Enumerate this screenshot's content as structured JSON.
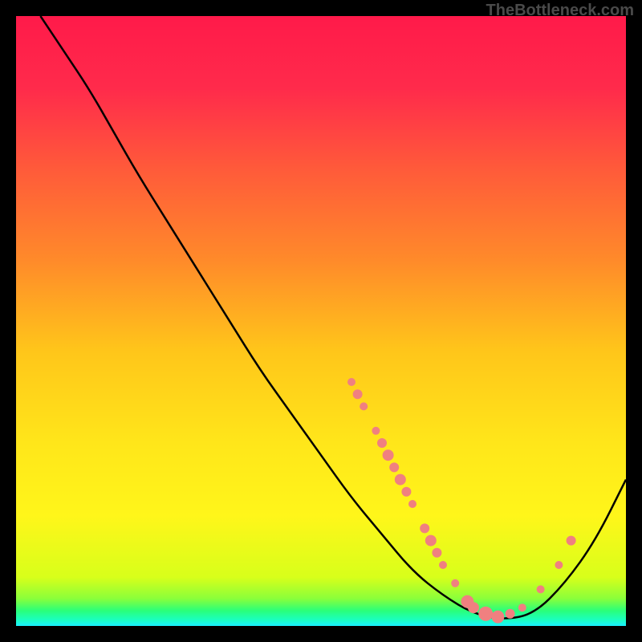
{
  "watermark": "TheBottleneck.com",
  "chart_data": {
    "type": "line",
    "title": "",
    "xlabel": "",
    "ylabel": "",
    "xlim": [
      0,
      100
    ],
    "ylim": [
      0,
      100
    ],
    "gradient_stops": [
      {
        "offset": 0,
        "color": "#ff1a4a"
      },
      {
        "offset": 0.12,
        "color": "#ff2b4b"
      },
      {
        "offset": 0.25,
        "color": "#ff5a3a"
      },
      {
        "offset": 0.4,
        "color": "#ff8a2a"
      },
      {
        "offset": 0.55,
        "color": "#ffc61a"
      },
      {
        "offset": 0.7,
        "color": "#ffe61a"
      },
      {
        "offset": 0.82,
        "color": "#fff61a"
      },
      {
        "offset": 0.92,
        "color": "#d8ff1a"
      },
      {
        "offset": 0.955,
        "color": "#8aff3a"
      },
      {
        "offset": 0.975,
        "color": "#2aff7a"
      },
      {
        "offset": 0.99,
        "color": "#1affc0"
      },
      {
        "offset": 1.0,
        "color": "#1af0ff"
      }
    ],
    "curve": [
      {
        "x": 4,
        "y": 100
      },
      {
        "x": 8,
        "y": 94
      },
      {
        "x": 12,
        "y": 88
      },
      {
        "x": 16,
        "y": 81
      },
      {
        "x": 20,
        "y": 74
      },
      {
        "x": 25,
        "y": 66
      },
      {
        "x": 30,
        "y": 58
      },
      {
        "x": 35,
        "y": 50
      },
      {
        "x": 40,
        "y": 42
      },
      {
        "x": 45,
        "y": 35
      },
      {
        "x": 50,
        "y": 28
      },
      {
        "x": 55,
        "y": 21
      },
      {
        "x": 60,
        "y": 15
      },
      {
        "x": 65,
        "y": 9
      },
      {
        "x": 70,
        "y": 5
      },
      {
        "x": 75,
        "y": 2
      },
      {
        "x": 80,
        "y": 1
      },
      {
        "x": 85,
        "y": 2
      },
      {
        "x": 90,
        "y": 7
      },
      {
        "x": 95,
        "y": 14
      },
      {
        "x": 100,
        "y": 24
      }
    ],
    "points": [
      {
        "x": 55,
        "y": 40,
        "r": 5
      },
      {
        "x": 56,
        "y": 38,
        "r": 6
      },
      {
        "x": 57,
        "y": 36,
        "r": 5
      },
      {
        "x": 59,
        "y": 32,
        "r": 5
      },
      {
        "x": 60,
        "y": 30,
        "r": 6
      },
      {
        "x": 61,
        "y": 28,
        "r": 7
      },
      {
        "x": 62,
        "y": 26,
        "r": 6
      },
      {
        "x": 63,
        "y": 24,
        "r": 7
      },
      {
        "x": 64,
        "y": 22,
        "r": 6
      },
      {
        "x": 65,
        "y": 20,
        "r": 5
      },
      {
        "x": 67,
        "y": 16,
        "r": 6
      },
      {
        "x": 68,
        "y": 14,
        "r": 7
      },
      {
        "x": 69,
        "y": 12,
        "r": 6
      },
      {
        "x": 70,
        "y": 10,
        "r": 5
      },
      {
        "x": 72,
        "y": 7,
        "r": 5
      },
      {
        "x": 74,
        "y": 4,
        "r": 8
      },
      {
        "x": 75,
        "y": 3,
        "r": 7
      },
      {
        "x": 77,
        "y": 2,
        "r": 9
      },
      {
        "x": 79,
        "y": 1.5,
        "r": 8
      },
      {
        "x": 81,
        "y": 2,
        "r": 6
      },
      {
        "x": 83,
        "y": 3,
        "r": 5
      },
      {
        "x": 86,
        "y": 6,
        "r": 5
      },
      {
        "x": 89,
        "y": 10,
        "r": 5
      },
      {
        "x": 91,
        "y": 14,
        "r": 6
      }
    ],
    "point_color": "#f08080"
  }
}
